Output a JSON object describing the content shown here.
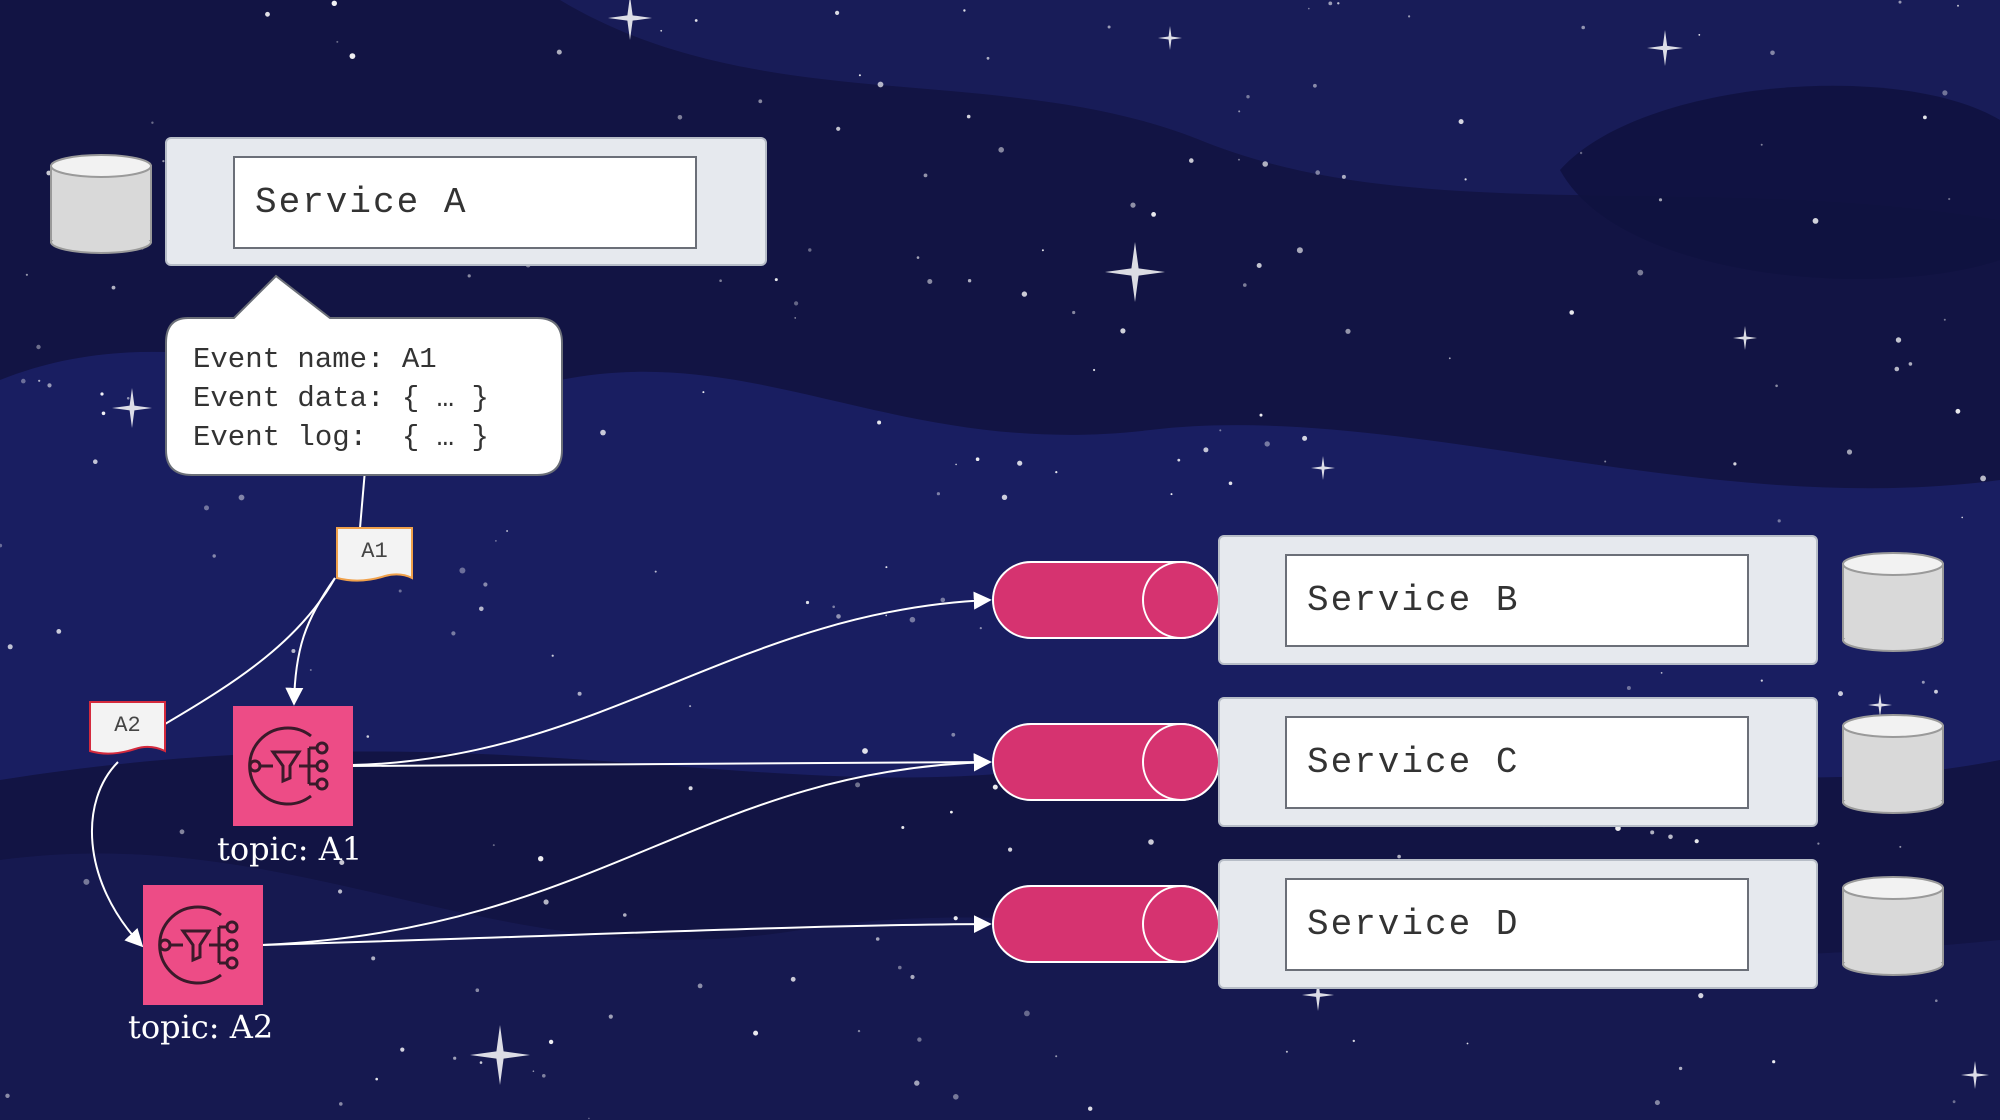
{
  "services": {
    "a": {
      "label": "Service A"
    },
    "b": {
      "label": "Service B"
    },
    "c": {
      "label": "Service C"
    },
    "d": {
      "label": "Service D"
    }
  },
  "event_callout": {
    "line1": "Event name: A1",
    "line2": "Event data: { … }",
    "line3": "Event log:  { … }"
  },
  "messages": {
    "a1": "A1",
    "a2": "A2"
  },
  "topics": {
    "a1": "topic: A1",
    "a2": "topic: A2"
  },
  "colors": {
    "background": "#121444",
    "queue": "#d63370",
    "topic_icon": "#ed4c86",
    "panel": "#e6e9ee",
    "tag_a1_border": "#f0a14b",
    "tag_a2_border": "#d42a3d"
  },
  "icons": {
    "database": "database-cylinder-icon",
    "topic": "sns-topic-icon",
    "queue": "queue-cylinder-icon"
  }
}
